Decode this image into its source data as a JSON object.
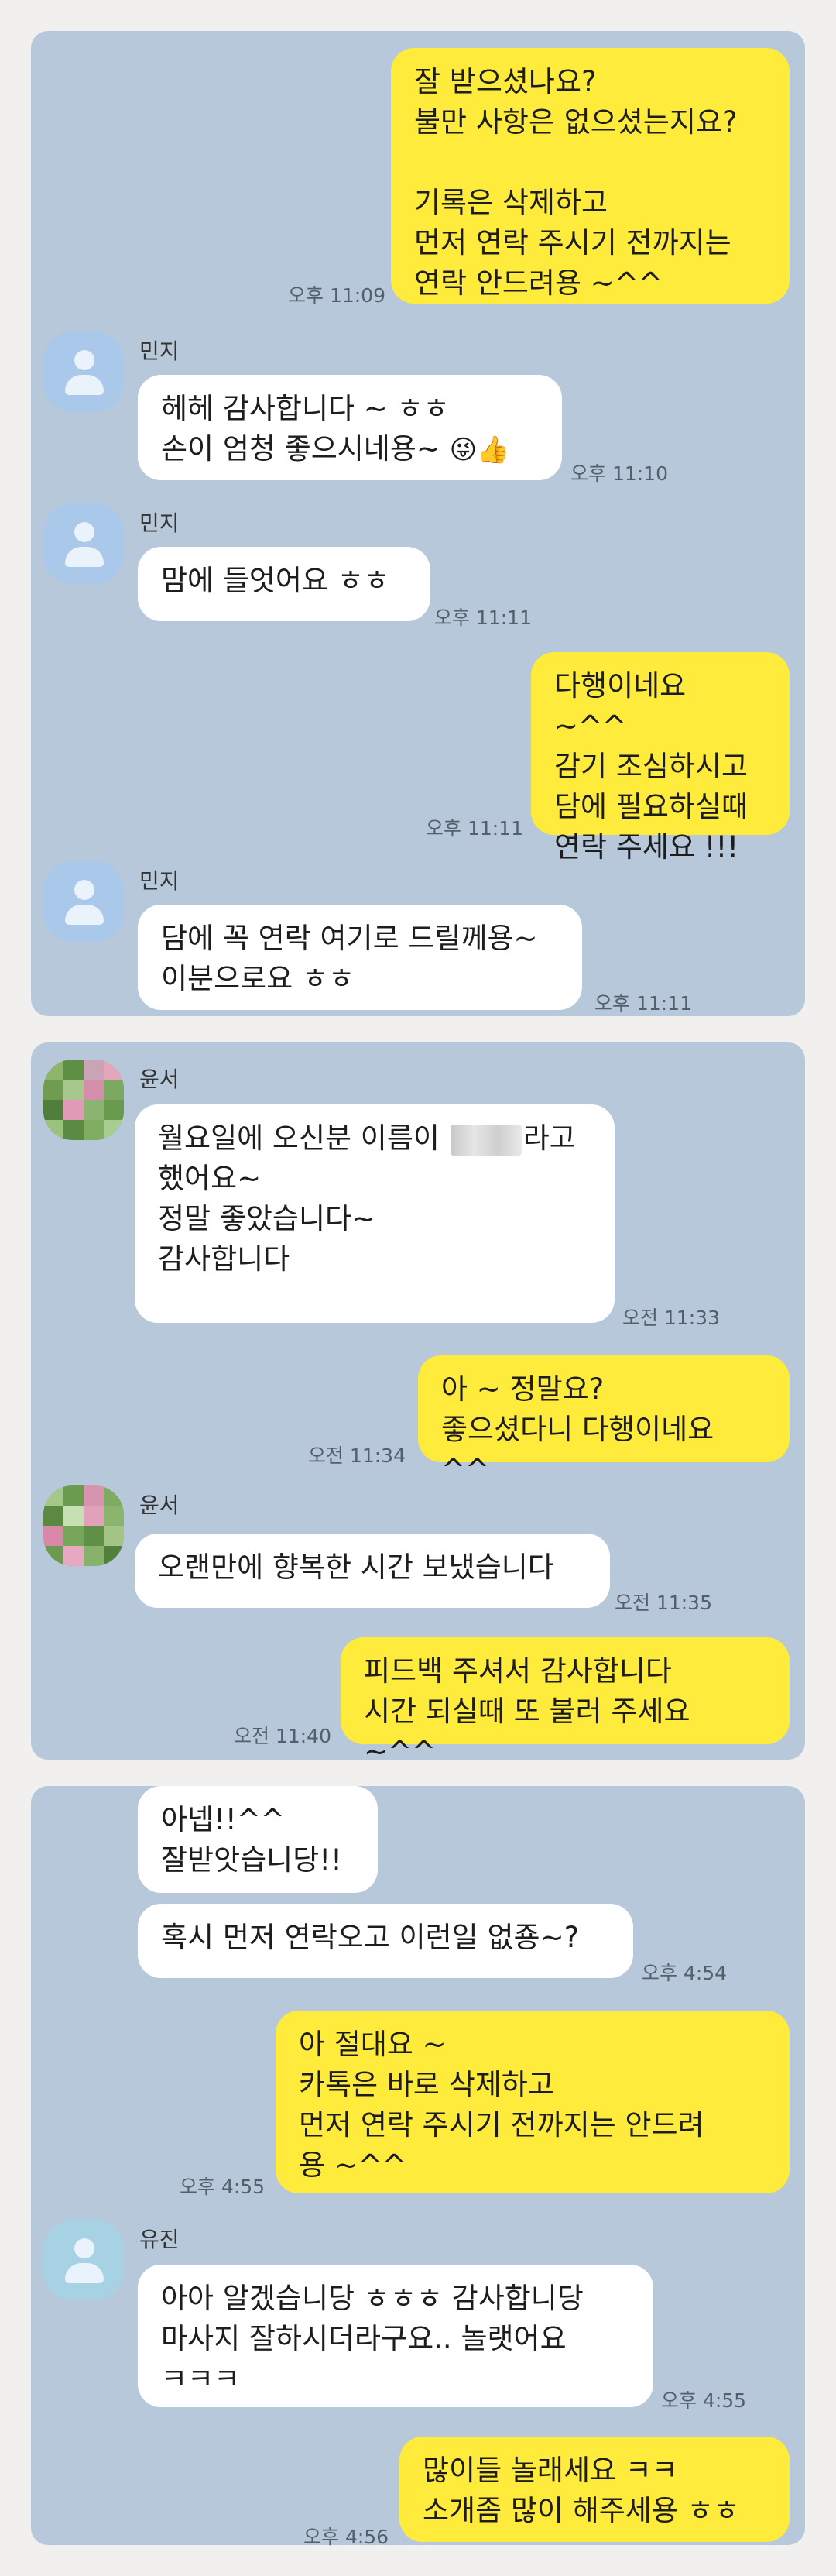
{
  "panel1": {
    "m1": {
      "text": "잘 받으셨나요?\n불만 사항은 없으셨는지요?\n\n기록은 삭제하고\n먼저 연락 주시기 전까지는\n연락 안드려용 ~^^",
      "time": "오후 11:09"
    },
    "m2": {
      "name": "민지",
      "text": "헤헤 감사합니다 ~ ㅎㅎ\n손이 엄청 좋으시네용~ ",
      "emoji": "😜👍",
      "time": "오후 11:10"
    },
    "m3": {
      "name": "민지",
      "text": "맘에 들엇어요 ㅎㅎ",
      "time": "오후 11:11"
    },
    "m4": {
      "text": "다행이네요 ~^^\n감기 조심하시고\n담에 필요하실때\n연락 주세요 !!!",
      "time": "오후 11:11"
    },
    "m5": {
      "name": "민지",
      "text": "담에 꼭 연락 여기로 드릴께용~\n이분으로요 ㅎㅎ",
      "time": "오후 11:11"
    }
  },
  "panel2": {
    "m1": {
      "name": "윤서",
      "text_before": "월요일에 오신분 이름이 ",
      "text_after": "라고\n했어요~\n정말 좋았습니다~\n감사합니다",
      "time": "오전 11:33"
    },
    "m2": {
      "text": "아 ~ 정말요?\n좋으셨다니 다행이네요 ^^",
      "time": "오전 11:34"
    },
    "m3": {
      "name": "윤서",
      "text": "오랜만에 향복한 시간 보냈습니다",
      "time": "오전 11:35"
    },
    "m4": {
      "text": "피드백 주셔서 감사합니다\n시간 되실때 또 불러 주세요 ~^^",
      "time": "오전 11:40"
    }
  },
  "panel3": {
    "m1": {
      "text": "아넵!!^^\n잘받앗습니당!!"
    },
    "m2": {
      "text": "혹시 먼저 연락오고 이런일 없죵~?",
      "time": "오후 4:54"
    },
    "m3": {
      "text": "아 절대요 ~\n카톡은 바로 삭제하고\n먼저 연락 주시기 전까지는 안드려\n용 ~^^",
      "time": "오후 4:55"
    },
    "m4": {
      "name": "유진",
      "text": "아아 알겠습니당 ㅎㅎㅎ 감사합니당\n마사지 잘하시더라구요.. 놀랫어요\nㅋㅋㅋ",
      "time": "오후 4:55"
    },
    "m5": {
      "text": "많이들 놀래세요 ㅋㅋ\n소개좀 많이 해주세용 ㅎㅎ",
      "time": "오후 4:56"
    }
  },
  "colors": {
    "chat_bg": "#b6c8d9",
    "sent_bubble": "#ffeb3b",
    "received_bubble": "#ffffff",
    "page_bg": "#f2f0ee"
  }
}
